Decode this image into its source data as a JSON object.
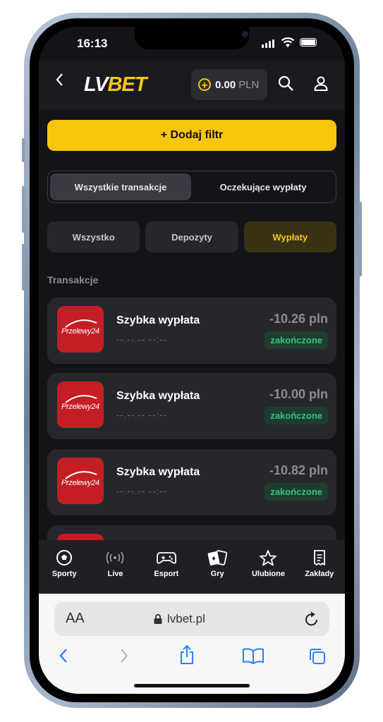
{
  "status_bar": {
    "time": "16:13"
  },
  "header": {
    "logo_lv": "LV",
    "logo_bet": "BET",
    "balance_amount": "0.00",
    "balance_currency": "PLN"
  },
  "filters": {
    "add_filter_label": "+ Dodaj filtr",
    "segment_tabs": [
      {
        "label": "Wszystkie transakcje",
        "active": true
      },
      {
        "label": "Oczekujące wypłaty",
        "active": false
      }
    ],
    "type_chips": [
      {
        "label": "Wszystko",
        "active": false
      },
      {
        "label": "Depozyty",
        "active": false
      },
      {
        "label": "Wypłaty",
        "active": true
      }
    ]
  },
  "transactions": {
    "section_title": "Transakcje",
    "logo_text": "Przelewy24",
    "items": [
      {
        "title": "Szybka wypłata",
        "date": "--.--.-- --:--",
        "amount": "-10.26 pln",
        "status": "zakończone"
      },
      {
        "title": "Szybka wypłata",
        "date": "--.--.-- --:--",
        "amount": "-10.00 pln",
        "status": "zakończone"
      },
      {
        "title": "Szybka wypłata",
        "date": "--.--.-- --:--",
        "amount": "-10.82 pln",
        "status": "zakończone"
      }
    ]
  },
  "bottom_nav": [
    {
      "label": "Sporty",
      "icon": "soccer-ball-icon"
    },
    {
      "label": "Live",
      "icon": "broadcast-icon"
    },
    {
      "label": "Esport",
      "icon": "gamepad-icon"
    },
    {
      "label": "Gry",
      "icon": "cards-icon"
    },
    {
      "label": "Ulubione",
      "icon": "star-icon"
    },
    {
      "label": "Zakłady",
      "icon": "receipt-icon"
    }
  ],
  "browser": {
    "aa_label": "AA",
    "url": "lvbet.pl"
  },
  "colors": {
    "accent": "#f7c50b",
    "background": "#131417",
    "card": "#26272c",
    "status_green": "#36c47c",
    "p24_red": "#c41e24"
  }
}
